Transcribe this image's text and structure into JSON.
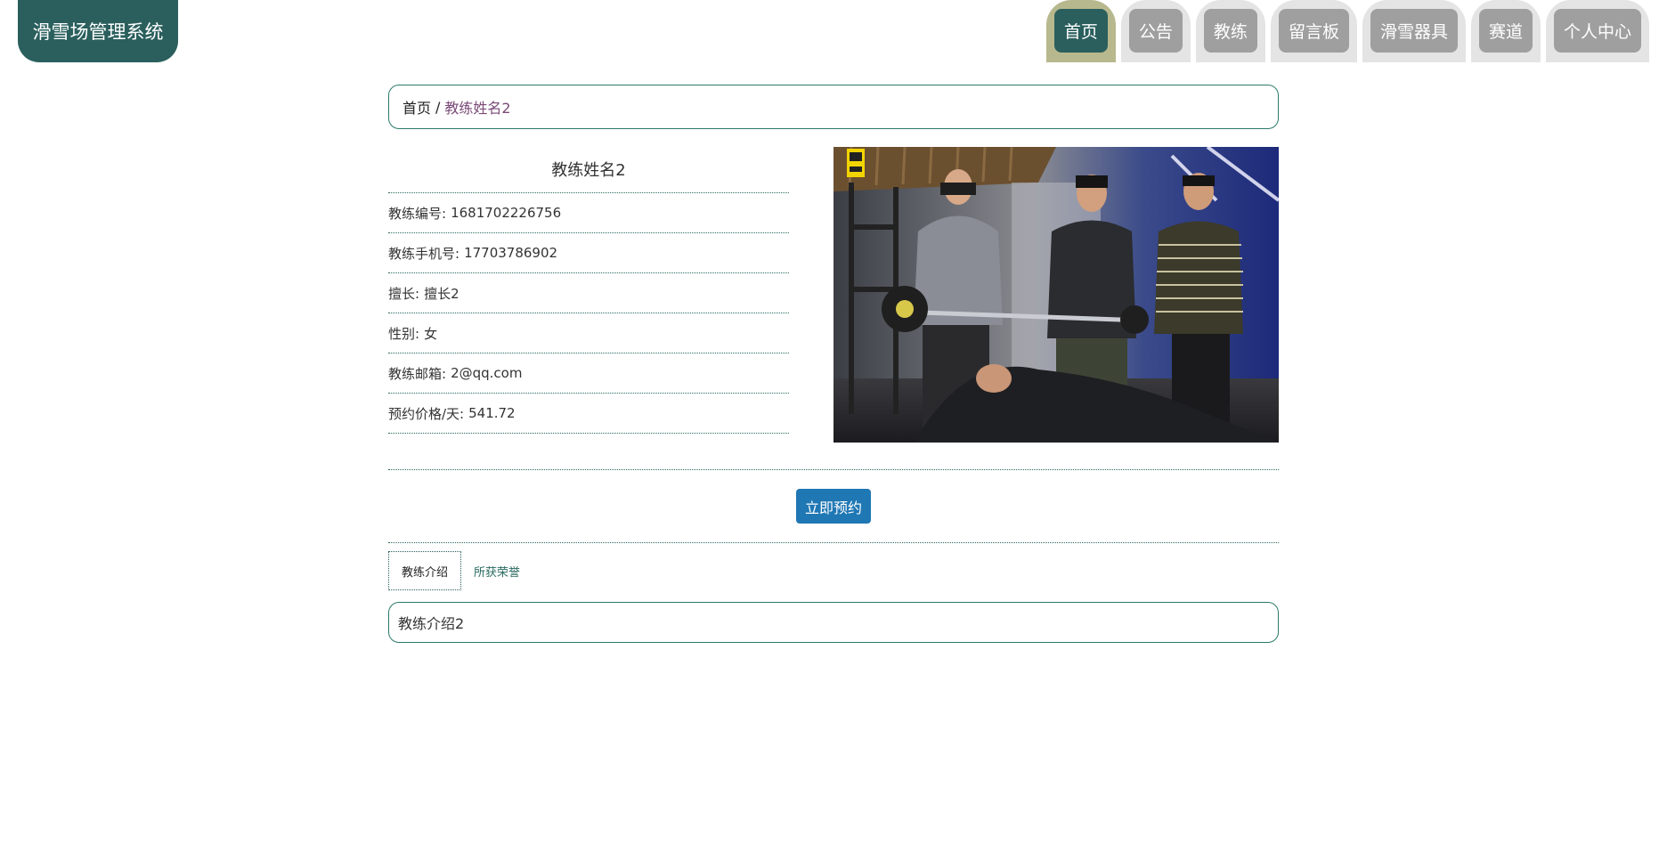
{
  "app": {
    "title": "滑雪场管理系统"
  },
  "nav": {
    "items": [
      {
        "label": "首页",
        "active": true
      },
      {
        "label": "公告",
        "active": false
      },
      {
        "label": "教练",
        "active": false
      },
      {
        "label": "留言板",
        "active": false
      },
      {
        "label": "滑雪器具",
        "active": false
      },
      {
        "label": "赛道",
        "active": false
      },
      {
        "label": "个人中心",
        "active": false
      }
    ]
  },
  "breadcrumb": {
    "home": "首页",
    "separator": "/",
    "current": "教练姓名2"
  },
  "coach": {
    "name": "教练姓名2",
    "fields": [
      {
        "label": "教练编号:",
        "value": "1681702226756"
      },
      {
        "label": "教练手机号:",
        "value": "17703786902"
      },
      {
        "label": "擅长:",
        "value": "擅长2"
      },
      {
        "label": "性别:",
        "value": "女"
      },
      {
        "label": "教练邮箱:",
        "value": "2@qq.com"
      },
      {
        "label": "预约价格/天:",
        "value": "541.72"
      }
    ]
  },
  "actions": {
    "book_label": "立即预约"
  },
  "tabs": [
    {
      "label": "教练介绍",
      "active": true
    },
    {
      "label": "所获荣誉",
      "active": false
    }
  ],
  "intro": {
    "text": "教练介绍2"
  },
  "colors": {
    "primary": "#2a5f5d",
    "nav_active_bg": "#b8b88e",
    "nav_inactive": "#9f9f9f",
    "button": "#1f77b4",
    "breadcrumb_current": "#7a4a78"
  }
}
